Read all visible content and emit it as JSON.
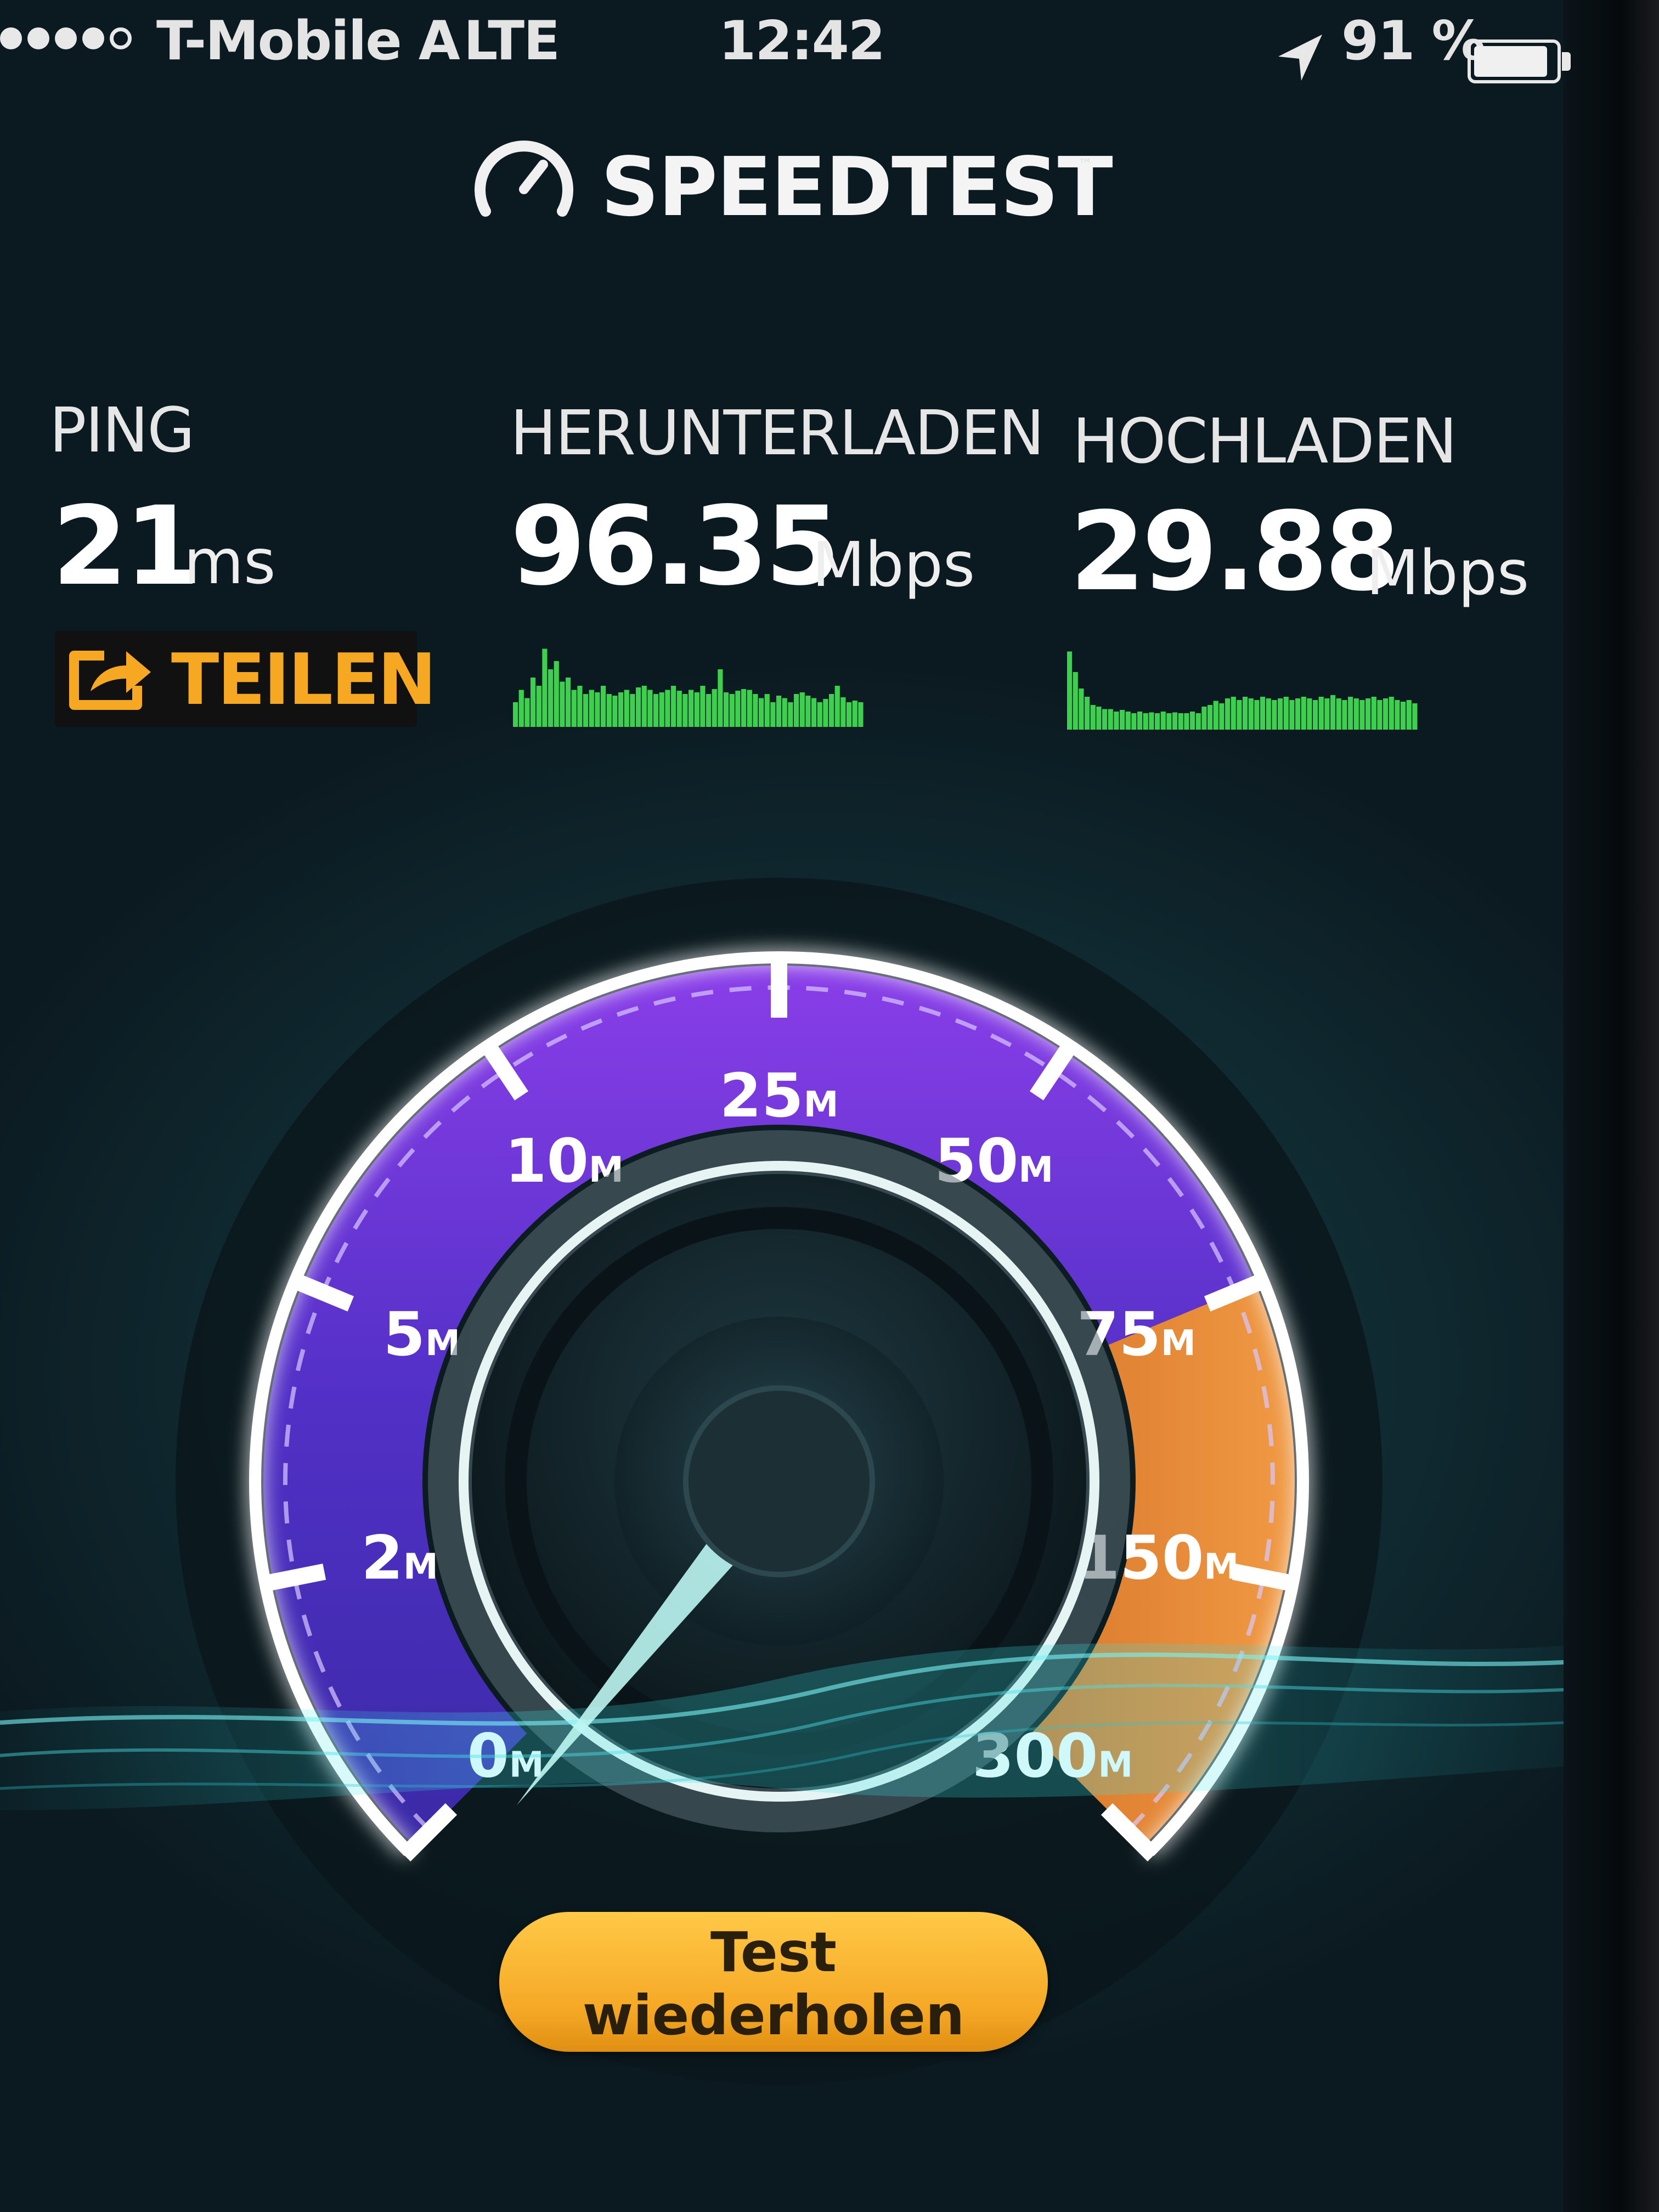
{
  "status_bar": {
    "carrier": "T-Mobile A",
    "network": "LTE",
    "time": "12:42",
    "battery_percent_text": "91 %",
    "battery_level": 0.91,
    "signal_bars": 4,
    "signal_total": 5
  },
  "header": {
    "title": "SPEEDTEST",
    "trademark": "™"
  },
  "metrics": {
    "ping": {
      "label": "PING",
      "value": "21",
      "unit": "ms"
    },
    "download": {
      "label": "HERUNTERLADEN",
      "value": "96.35",
      "unit": "Mbps"
    },
    "upload": {
      "label": "HOCHLADEN",
      "value": "29.88",
      "unit": "Mbps"
    }
  },
  "share": {
    "label": "TEILEN"
  },
  "gauge": {
    "scale_labels": [
      "0",
      "2",
      "5",
      "10",
      "25",
      "50",
      "75",
      "150",
      "300"
    ],
    "unit_suffix": "M",
    "needle_value_mbps": 0,
    "highlight_from_mbps": 75
  },
  "actions": {
    "retest_line1": "Test",
    "retest_line2": "wiederholen"
  },
  "colors": {
    "accent_orange": "#f7a823",
    "gauge_purple": "#5b2fc9",
    "spark_green": "#3ecf4e",
    "background_teal": "#123038"
  }
}
